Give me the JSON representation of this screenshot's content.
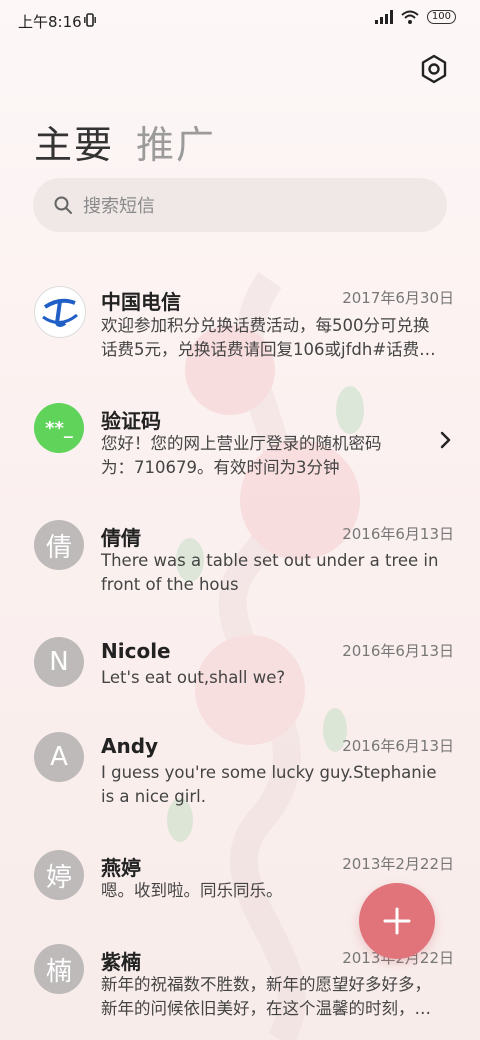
{
  "status_bar": {
    "time": "上午8:16",
    "battery": "100"
  },
  "tabs": [
    {
      "label": "主要",
      "active": true
    },
    {
      "label": "推广",
      "active": false
    }
  ],
  "search": {
    "placeholder": "搜索短信"
  },
  "messages": [
    {
      "avatar_text": "",
      "avatar_type": "telecom-logo",
      "sender": "中国电信",
      "date": "2017年6月30日",
      "preview_lines": [
        "欢迎参加积分兑换话费活动，每500分可兑换",
        "话费5元，兑换话费请回复106或jfdh#话费…"
      ]
    },
    {
      "avatar_text": "**_",
      "avatar_type": "green",
      "sender": "验证码",
      "date": "",
      "preview_lines": [
        "您好！您的网上营业厅登录的随机密码",
        "为：710679。有效时间为3分钟"
      ]
    },
    {
      "avatar_text": "倩",
      "avatar_type": "gray",
      "sender": "倩倩",
      "date": "2016年6月13日",
      "preview_lines": [
        "There was a table set out under a tree in",
        "front of the hous"
      ]
    },
    {
      "avatar_text": "N",
      "avatar_type": "gray",
      "sender": "Nicole",
      "date": "2016年6月13日",
      "preview_lines": [
        "Let's eat out,shall we?"
      ]
    },
    {
      "avatar_text": "A",
      "avatar_type": "gray",
      "sender": "Andy",
      "date": "2016年6月13日",
      "preview_lines": [
        "I guess you're some lucky guy.Stephanie",
        "is a nice girl."
      ]
    },
    {
      "avatar_text": "婷",
      "avatar_type": "gray",
      "sender": "燕婷",
      "date": "2013年2月22日",
      "preview_lines": [
        "嗯。收到啦。同乐同乐。"
      ]
    },
    {
      "avatar_text": "楠",
      "avatar_type": "gray",
      "sender": "紫楠",
      "date": "2013年2月22日",
      "preview_lines": [
        "新年的祝福数不胜数，新年的愿望好多好多，",
        "新年的问候依旧美好，在这个温馨的时刻，…"
      ]
    }
  ],
  "colors": {
    "fab": "#e0747a",
    "verification_avatar": "#5fd35a",
    "avatar_gray": "#bdbab9"
  },
  "icons": {
    "settings": "settings-hexagon-icon",
    "search": "search-icon",
    "fab": "plus-icon",
    "chevron": "chevron-right-icon"
  }
}
